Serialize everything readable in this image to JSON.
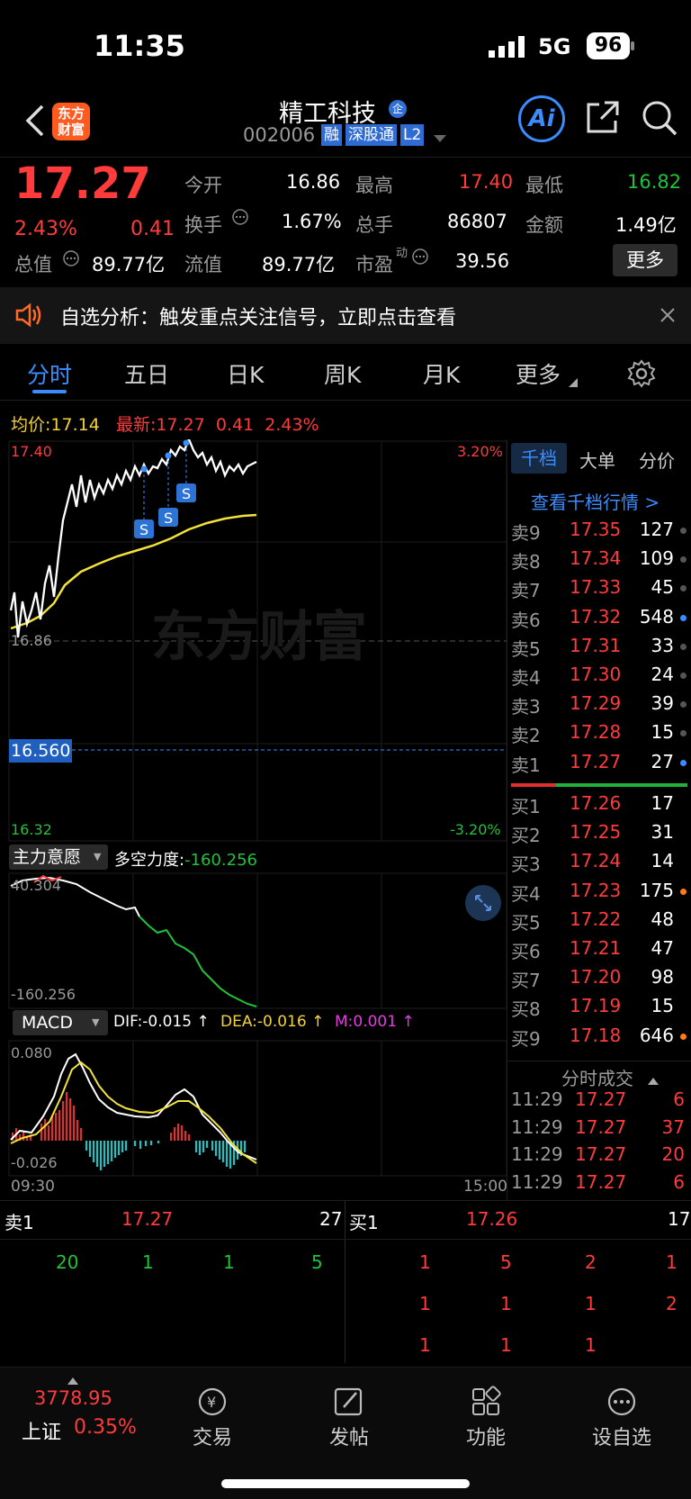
{
  "status_bar": {
    "time": "11:35",
    "network": "5G",
    "battery": "96"
  },
  "header": {
    "logo_text": "东方\n财富",
    "stock_name": "精工科技",
    "ent_badge": "企",
    "code": "002006",
    "tags": [
      "融",
      "深股通",
      "L2"
    ],
    "ai_label": "Ai"
  },
  "quote": {
    "price": "17.27",
    "change_pct": "2.43%",
    "change": "0.41",
    "stats": [
      {
        "label": "今开",
        "value": "16.86",
        "color": "white"
      },
      {
        "label": "最高",
        "value": "17.40",
        "color": "red"
      },
      {
        "label": "最低",
        "value": "16.82",
        "color": "green"
      },
      {
        "label": "换手",
        "value": "1.67%",
        "color": "white"
      },
      {
        "label": "总手",
        "value": "86807",
        "color": "white"
      },
      {
        "label": "金额",
        "value": "1.49亿",
        "color": "white"
      },
      {
        "label": "总值",
        "value": "89.77亿",
        "color": "white"
      },
      {
        "label": "流值",
        "value": "89.77亿",
        "color": "white"
      },
      {
        "label": "市盈",
        "value": "39.56",
        "color": "white"
      }
    ],
    "pe_sup": "动",
    "more_button": "更多"
  },
  "banner": {
    "text": "自选分析：触发重点关注信号，立即点击查看"
  },
  "tabs": [
    "分时",
    "五日",
    "日K",
    "周K",
    "月K",
    "更多"
  ],
  "intraday": {
    "avg_label": "均价:",
    "avg_value": "17.14",
    "latest_label": "最新:",
    "latest_value": "17.27",
    "latest_change": "0.41",
    "latest_pct": "2.43%",
    "y_max": "17.40",
    "y_max_pct": "3.20%",
    "y_mid": "16.86",
    "y_min": "16.32",
    "y_min_pct": "-3.20%",
    "crosshair_price": "16.560",
    "watermark": "东方财富",
    "signal_marker": "S"
  },
  "force": {
    "select_label": "主力意愿",
    "force_label": "多空力度:",
    "force_value": "-160.256",
    "top": "40.304",
    "bottom": "-160.256"
  },
  "macd": {
    "select_label": "MACD",
    "dif": "DIF:-0.015 ↑",
    "dea": "DEA:-0.016 ↑",
    "m": "M:0.001 ↑",
    "top": "0.080",
    "bottom": "-0.026",
    "time_start": "09:30",
    "time_end": "15:00"
  },
  "orderbook": {
    "tab_active": "千档",
    "tabs": [
      "千档",
      "大单",
      "分价"
    ],
    "link": "查看千档行情 >",
    "asks": [
      {
        "label": "卖9",
        "price": "17.35",
        "vol": "127",
        "dot": "gray"
      },
      {
        "label": "卖8",
        "price": "17.34",
        "vol": "109",
        "dot": "gray"
      },
      {
        "label": "卖7",
        "price": "17.33",
        "vol": "45",
        "dot": "gray"
      },
      {
        "label": "卖6",
        "price": "17.32",
        "vol": "548",
        "dot": "blue"
      },
      {
        "label": "卖5",
        "price": "17.31",
        "vol": "33",
        "dot": "gray"
      },
      {
        "label": "卖4",
        "price": "17.30",
        "vol": "24",
        "dot": "gray"
      },
      {
        "label": "卖3",
        "price": "17.29",
        "vol": "39",
        "dot": "gray"
      },
      {
        "label": "卖2",
        "price": "17.28",
        "vol": "15",
        "dot": "gray"
      },
      {
        "label": "卖1",
        "price": "17.27",
        "vol": "27",
        "dot": "blue"
      }
    ],
    "bids": [
      {
        "label": "买1",
        "price": "17.26",
        "vol": "17",
        "dot": "none"
      },
      {
        "label": "买2",
        "price": "17.25",
        "vol": "31",
        "dot": "none"
      },
      {
        "label": "买3",
        "price": "17.24",
        "vol": "14",
        "dot": "none"
      },
      {
        "label": "买4",
        "price": "17.23",
        "vol": "175",
        "dot": "orange"
      },
      {
        "label": "买5",
        "price": "17.22",
        "vol": "48",
        "dot": "none"
      },
      {
        "label": "买6",
        "price": "17.21",
        "vol": "47",
        "dot": "none"
      },
      {
        "label": "买7",
        "price": "17.20",
        "vol": "98",
        "dot": "none"
      },
      {
        "label": "买8",
        "price": "17.19",
        "vol": "15",
        "dot": "none"
      },
      {
        "label": "买9",
        "price": "17.18",
        "vol": "646",
        "dot": "orange"
      }
    ],
    "trades_title": "分时成交",
    "trades": [
      {
        "time": "11:29",
        "price": "17.27",
        "vol": "6"
      },
      {
        "time": "11:29",
        "price": "17.27",
        "vol": "37"
      },
      {
        "time": "11:29",
        "price": "17.27",
        "vol": "20"
      },
      {
        "time": "11:29",
        "price": "17.27",
        "vol": "6"
      }
    ]
  },
  "queue": {
    "sell_label": "卖1",
    "sell_price": "17.27",
    "sell_vol": "27",
    "buy_label": "买1",
    "buy_price": "17.26",
    "buy_vol": "17",
    "sell_orders": [
      "20",
      "1",
      "1",
      "5"
    ],
    "buy_orders": [
      [
        "1",
        "5",
        "2",
        "1"
      ],
      [
        "1",
        "1",
        "1",
        "2"
      ],
      [
        "1",
        "1",
        "1"
      ]
    ]
  },
  "bottom_nav": {
    "index_value": "3778.95",
    "index_name": "上证",
    "index_pct": "0.35%",
    "items": [
      "交易",
      "发帖",
      "功能",
      "设自选"
    ]
  },
  "colors": {
    "red": "#ff3b3b",
    "green": "#21c23a",
    "blue": "#3b8cff",
    "yellow": "#f2d23a",
    "bg": "#000000"
  }
}
